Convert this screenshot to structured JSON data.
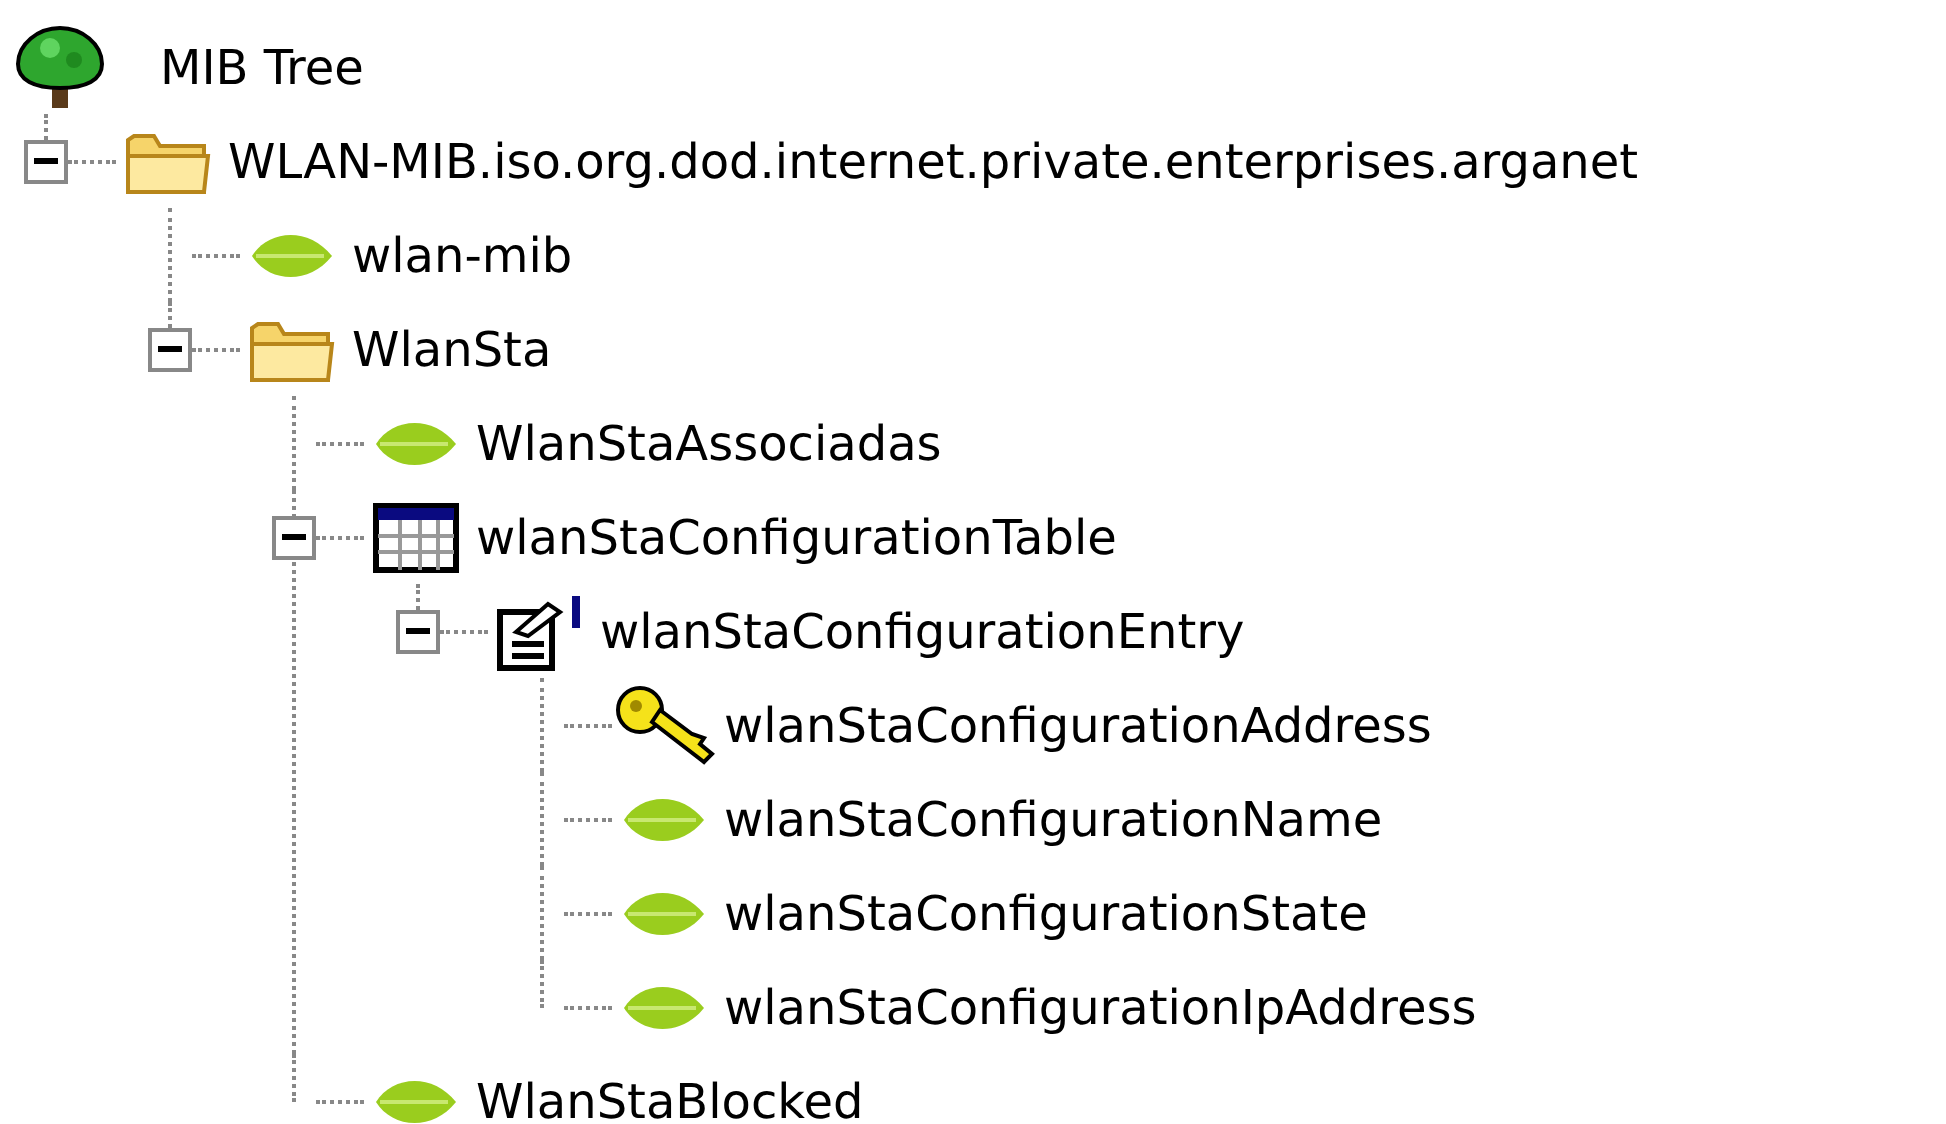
{
  "tree": {
    "label": "MIB Tree",
    "kind": "root",
    "children": [
      {
        "label": "WLAN-MIB.iso.org.dod.internet.private.enterprises.arganet",
        "kind": "folder",
        "expanded": true,
        "children": [
          {
            "label": "wlan-mib",
            "kind": "leaf"
          },
          {
            "label": "WlanSta",
            "kind": "folder",
            "expanded": true,
            "children": [
              {
                "label": "WlanStaAssociadas",
                "kind": "leaf"
              },
              {
                "label": "wlanStaConfigurationTable",
                "kind": "table",
                "expanded": true,
                "children": [
                  {
                    "label": "wlanStaConfigurationEntry",
                    "kind": "entry",
                    "expanded": true,
                    "children": [
                      {
                        "label": "wlanStaConfigurationAddress",
                        "kind": "key"
                      },
                      {
                        "label": "wlanStaConfigurationName",
                        "kind": "leaf"
                      },
                      {
                        "label": "wlanStaConfigurationState",
                        "kind": "leaf"
                      },
                      {
                        "label": "wlanStaConfigurationIpAddress",
                        "kind": "leaf"
                      }
                    ]
                  }
                ]
              },
              {
                "label": "WlanStaBlocked",
                "kind": "leaf"
              }
            ]
          }
        ]
      }
    ]
  }
}
